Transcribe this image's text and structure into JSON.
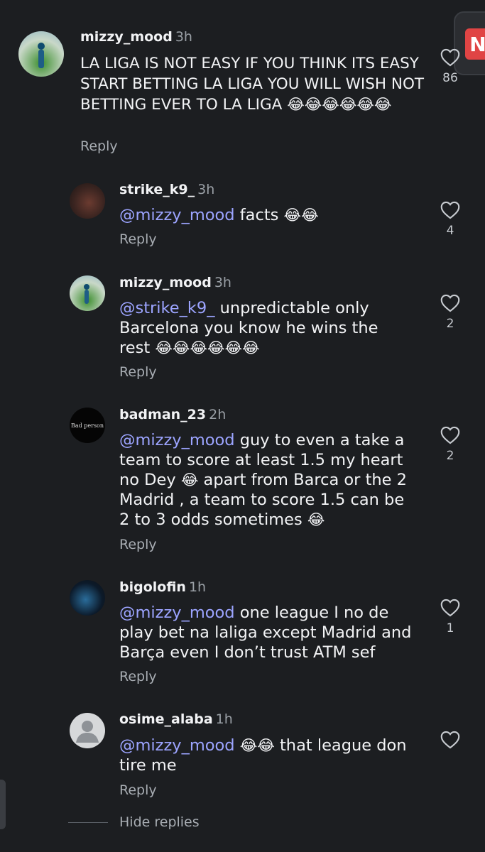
{
  "comments": [
    {
      "username": "mizzy_mood",
      "time": "3h",
      "text": "LA LIGA IS NOT EASY IF YOU THINK ITS EASY START BETTING LA LIGA YOU WILL WISH NOT BETTING EVER TO LA LIGA",
      "emoji": "😂😂😂😂😂😂",
      "reply_label": "Reply",
      "likes": "86"
    },
    {
      "username": "strike_k9_",
      "time": "3h",
      "mention": "@mizzy_mood",
      "text": "facts",
      "emoji": "😂😂",
      "reply_label": "Reply",
      "likes": "4"
    },
    {
      "username": "mizzy_mood",
      "time": "3h",
      "mention": "@strike_k9_",
      "text": "unpredictable only Barcelona you know he wins the rest",
      "emoji": "😂😂😂😂😂😂",
      "reply_label": "Reply",
      "likes": "2"
    },
    {
      "username": "badman_23",
      "time": "2h",
      "avatar_text": "Bad person",
      "mention": "@mizzy_mood",
      "text_a": "guy to even a take a team to score at least 1.5 my heart no Dey",
      "emoji_a": "😂",
      "text_b": "apart from Barca or the 2 Madrid , a team to score 1.5 can be 2 to 3 odds sometimes",
      "emoji_b": "😂",
      "reply_label": "Reply",
      "likes": "2"
    },
    {
      "username": "bigolofin",
      "time": "1h",
      "mention": "@mizzy_mood",
      "text": "one league I no de play bet na laliga except Madrid and Barça even I don’t trust ATM sef",
      "reply_label": "Reply",
      "likes": "1"
    },
    {
      "username": "osime_alaba",
      "time": "1h",
      "mention": "@mizzy_mood",
      "emoji": "😂😂",
      "text": "that league don tire me",
      "reply_label": "Reply"
    }
  ],
  "hide_replies": "Hide replies",
  "icons": {
    "like": "heart-outline-icon",
    "floating": "app-shortcut-icon"
  },
  "colors": {
    "background": "#1c1e21",
    "mention": "#9ca4ff",
    "muted": "#a8adb3"
  }
}
